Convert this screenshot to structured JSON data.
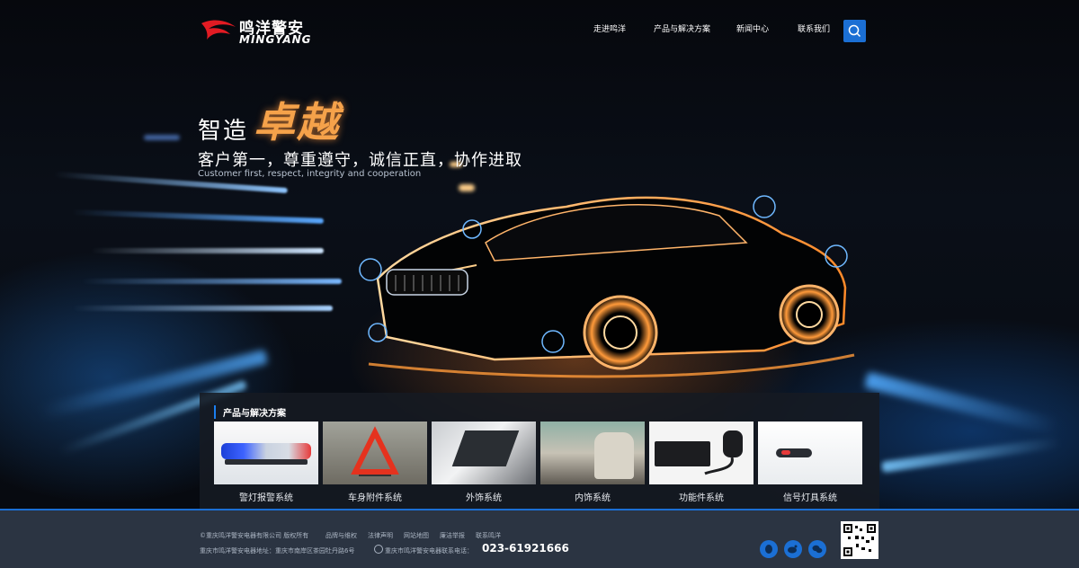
{
  "brand": {
    "name_cn": "鸣洋警安",
    "name_en": "MINGYANG"
  },
  "nav": {
    "items": [
      {
        "label": "走进鸣洋"
      },
      {
        "label": "产品与解决方案"
      },
      {
        "label": "新闻中心"
      },
      {
        "label": "联系我们"
      }
    ]
  },
  "hero": {
    "slogan_a": "智造",
    "slogan_b": "卓越",
    "motto": "客户第一，尊重遵守，诚信正直，协作进取",
    "motto_en": "Customer first, respect, integrity and cooperation"
  },
  "products": {
    "title": "产品与解决方案",
    "items": [
      {
        "label": "警灯报警系统"
      },
      {
        "label": "车身附件系统"
      },
      {
        "label": "外饰系统"
      },
      {
        "label": "内饰系统"
      },
      {
        "label": "功能件系统"
      },
      {
        "label": "信号灯具系统"
      }
    ]
  },
  "footer": {
    "copyright": "©重庆鸣洋警安电器有限公司 版权所有",
    "links": [
      "品牌与维权",
      "法律声明",
      "网站地图",
      "廉洁举报",
      "联系鸣洋"
    ],
    "address": "重庆市鸣洋警安电器地址：重庆市南岸区茶园牡丹路6号",
    "phone_label": "重庆市鸣洋警安电器联系电话：",
    "phone": "023-61921666"
  },
  "colors": {
    "accent": "#1b6fd4",
    "slogan_orange": "#f5a24a",
    "footer_bg": "#2b3442"
  }
}
